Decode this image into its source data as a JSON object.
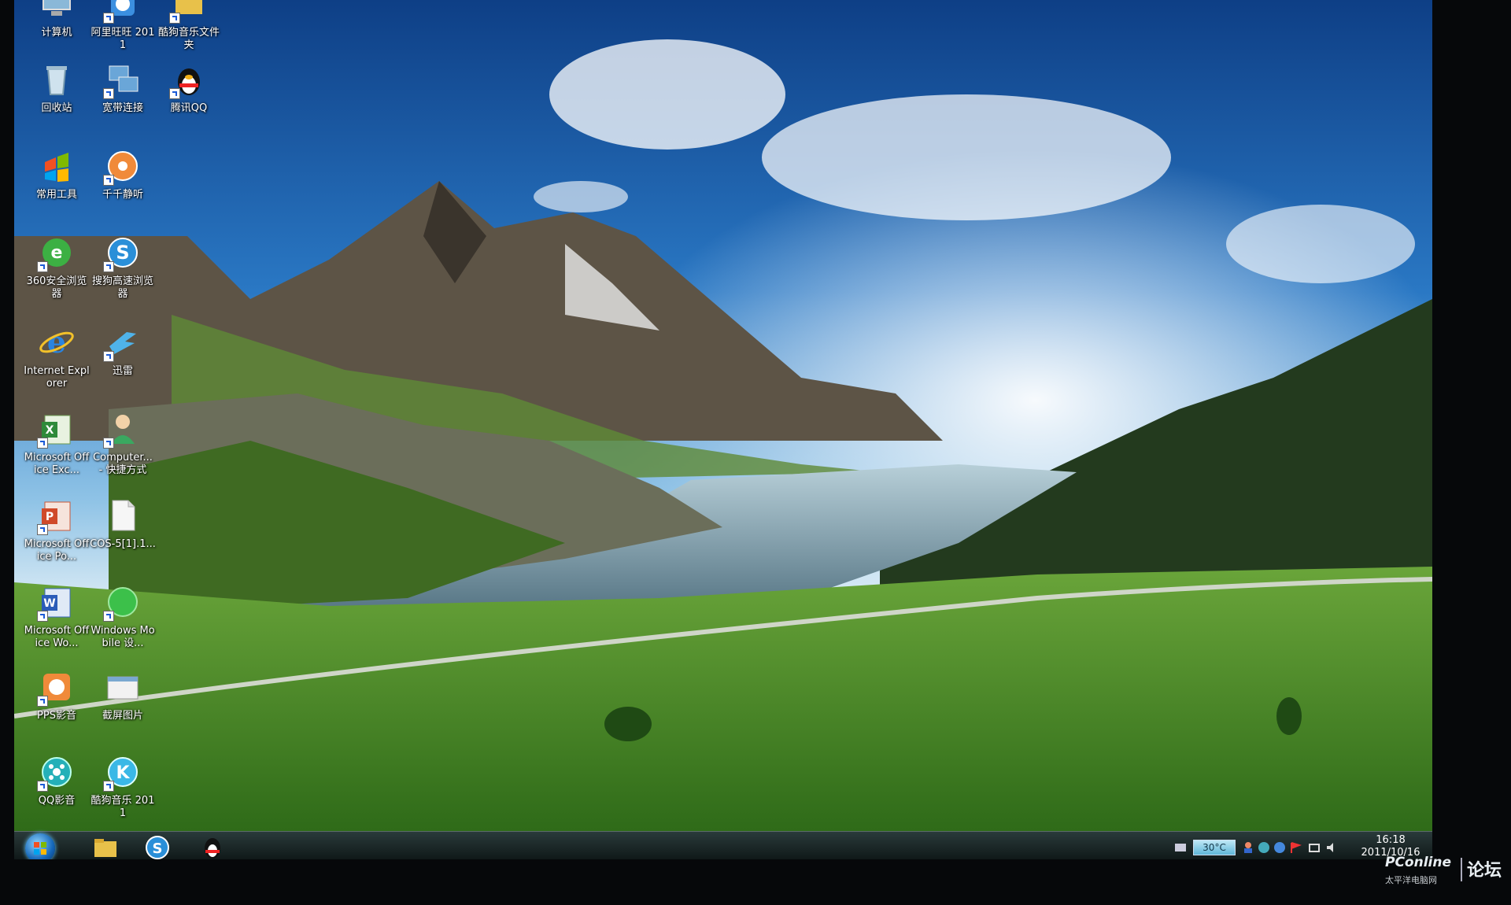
{
  "desktop": {
    "icons": [
      {
        "label": "计算机",
        "icon": "computer-icon"
      },
      {
        "label": "阿里旺旺 2011",
        "icon": "aliwangwang-icon"
      },
      {
        "label": "酷狗音乐文件夹",
        "icon": "folder-icon"
      },
      {
        "label": "回收站",
        "icon": "recycle-bin-icon"
      },
      {
        "label": "宽带连接",
        "icon": "network-icon"
      },
      {
        "label": "腾讯QQ",
        "icon": "qq-penguin-icon"
      },
      {
        "label": "常用工具",
        "icon": "tools-icon"
      },
      {
        "label": "千千静听",
        "icon": "music-player-icon"
      },
      {
        "label": "360安全浏览器",
        "icon": "360-browser-icon"
      },
      {
        "label": "搜狗高速浏览器",
        "icon": "sogou-browser-icon"
      },
      {
        "label": "Internet Explorer",
        "icon": "ie-icon"
      },
      {
        "label": "迅雷",
        "icon": "thunder-icon"
      },
      {
        "label": "Microsoft Office Exc...",
        "icon": "excel-icon"
      },
      {
        "label": "Computer... - 快捷方式",
        "icon": "shortcut-person-icon"
      },
      {
        "label": "Microsoft Office Po...",
        "icon": "powerpoint-icon"
      },
      {
        "label": "COS-5[1].1...",
        "icon": "document-icon"
      },
      {
        "label": "Microsoft Office Wo...",
        "icon": "word-icon"
      },
      {
        "label": "Windows Mobile 设...",
        "icon": "windows-mobile-icon"
      },
      {
        "label": "PPS影音",
        "icon": "pps-icon"
      },
      {
        "label": "截屏图片",
        "icon": "screenshot-folder-icon"
      },
      {
        "label": "QQ影音",
        "icon": "qq-player-icon"
      },
      {
        "label": "酷狗音乐 2011",
        "icon": "kugou-icon"
      }
    ]
  },
  "taskbar": {
    "pinned": [
      {
        "icon": "folder-icon"
      },
      {
        "icon": "sogou-browser-icon"
      },
      {
        "icon": "qq-penguin-icon"
      }
    ],
    "tray": {
      "weather": "30°C",
      "time": "16:18",
      "date": "2011/10/16"
    }
  },
  "watermark": {
    "logo": "PConline",
    "subtitle": "太平洋电脑网",
    "forum": "论坛"
  },
  "colors": {
    "sky": "#1d5fae",
    "grass": "#4e8f2a",
    "taskbar": "#1a2626"
  }
}
